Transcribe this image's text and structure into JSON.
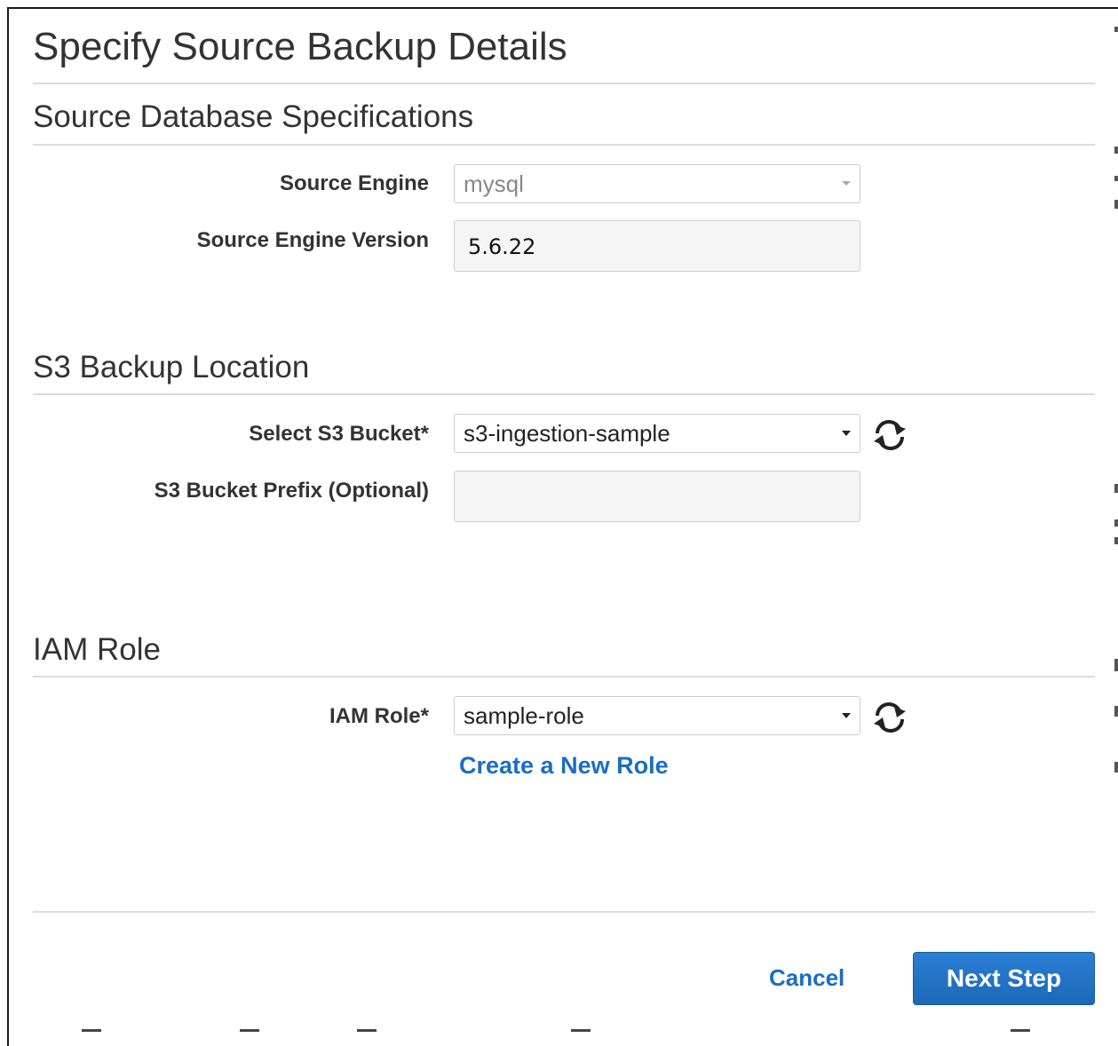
{
  "page": {
    "title": "Specify Source Backup Details"
  },
  "source_db": {
    "section_title": "Source Database Specifications",
    "engine_label": "Source Engine",
    "engine_value": "mysql",
    "version_label": "Source Engine Version",
    "version_value": "5.6.22"
  },
  "s3": {
    "section_title": "S3 Backup Location",
    "bucket_label": "Select S3 Bucket*",
    "bucket_value": "s3-ingestion-sample",
    "prefix_label": "S3 Bucket Prefix (Optional)",
    "prefix_value": ""
  },
  "iam": {
    "section_title": "IAM Role",
    "role_label": "IAM Role*",
    "role_value": "sample-role",
    "create_link": "Create a New Role"
  },
  "footer": {
    "cancel_label": "Cancel",
    "next_label": "Next Step"
  },
  "colors": {
    "primary_button": "#1d68b6",
    "link": "#1a6ec2",
    "text": "#333333"
  },
  "icons": {
    "refresh": "refresh-icon",
    "dropdown": "chevron-down-icon"
  }
}
